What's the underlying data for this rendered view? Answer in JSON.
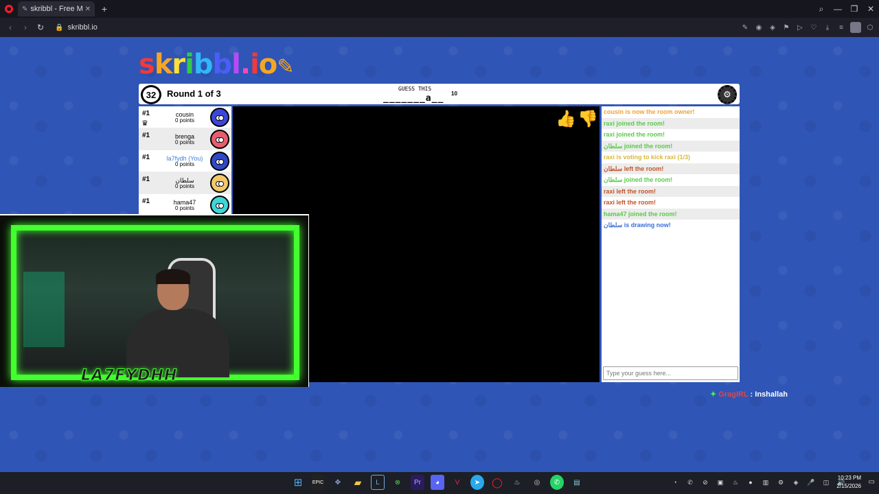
{
  "browser": {
    "tab_title": "skribbl - Free Multiplayer",
    "url": "skribbl.io"
  },
  "game": {
    "logo_text": "skribbl.io",
    "timer": "32",
    "round_text": "Round 1 of 3",
    "guess_label": "GUESS THIS",
    "word_hint": "_______a__",
    "word_length": "10"
  },
  "players": [
    {
      "rank": "#1",
      "name": "cousin",
      "points": "0 points",
      "owner": true,
      "you": false,
      "color": "#3b47d9"
    },
    {
      "rank": "#1",
      "name": "brenga",
      "points": "0 points",
      "owner": false,
      "you": false,
      "color": "#e85d6e"
    },
    {
      "rank": "#1",
      "name": "la7fydh (You)",
      "points": "0 points",
      "owner": false,
      "you": true,
      "color": "#3049c9"
    },
    {
      "rank": "#1",
      "name": "سلطان",
      "points": "0 points",
      "owner": false,
      "you": false,
      "color": "#f2c96a"
    },
    {
      "rank": "#1",
      "name": "hama47",
      "points": "0 points",
      "owner": false,
      "you": false,
      "color": "#3fd6d9"
    }
  ],
  "chat": {
    "messages": [
      {
        "text": "cousin is now the room owner!",
        "color": "#f0a23a"
      },
      {
        "text": "raxi joined the room!",
        "color": "#5bc94a"
      },
      {
        "text": "raxi joined the room!",
        "color": "#5bc94a"
      },
      {
        "text": "سلطان joined the room!",
        "color": "#5bc94a"
      },
      {
        "text": "raxi is voting to kick raxi (1/3)",
        "color": "#d9b93a"
      },
      {
        "text": "سلطان left the room!",
        "color": "#c0552a"
      },
      {
        "text": "سلطان joined the room!",
        "color": "#5bc94a"
      },
      {
        "text": "raxi left the room!",
        "color": "#c0552a"
      },
      {
        "text": "raxi left the room!",
        "color": "#c0552a"
      },
      {
        "text": "hama47 joined the room!",
        "color": "#5bc94a"
      },
      {
        "text": "سلطان is drawing now!",
        "color": "#3b6fd8"
      }
    ],
    "input_placeholder": "Type your guess here..."
  },
  "webcam": {
    "name": "LA7FYDHH"
  },
  "stream_chat": {
    "user": "GragIRL",
    "separator": " : ",
    "message": "Inshallah"
  },
  "taskbar": {
    "time": "10:23 PM",
    "date": "2/15/2026"
  }
}
